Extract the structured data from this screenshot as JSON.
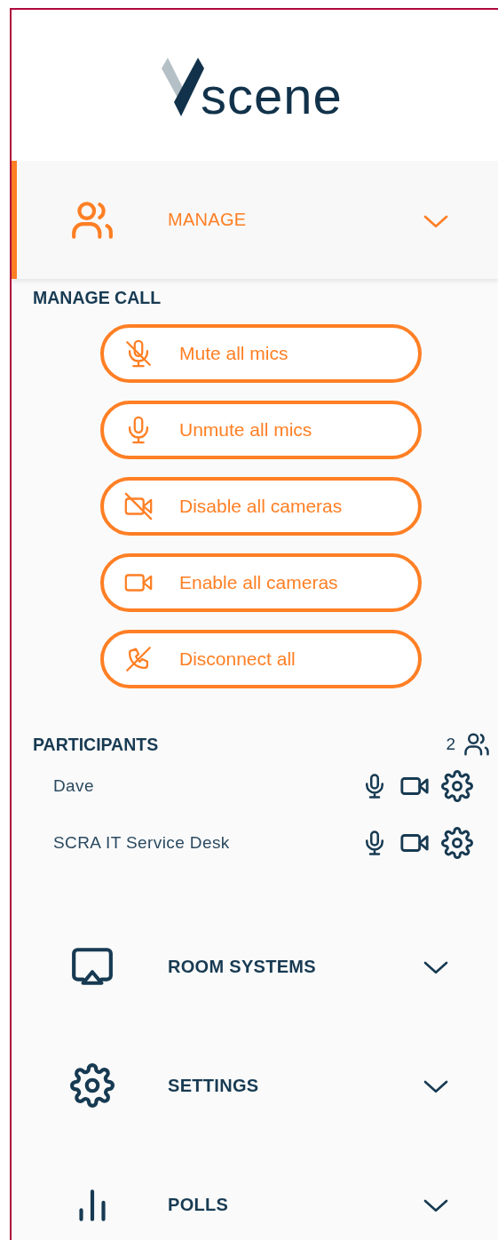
{
  "logo": {
    "text": "scene"
  },
  "sections": [
    {
      "label": "MANAGE",
      "selected": true,
      "manage_call": {
        "heading": "MANAGE CALL",
        "buttons": [
          "Mute all mics",
          "Unmute all mics",
          "Disable all cameras",
          "Enable all cameras",
          "Disconnect all"
        ]
      },
      "participants": {
        "heading": "PARTICIPANTS",
        "count": "2",
        "rows": [
          {
            "name": "Dave",
            "mic_muted": false,
            "camera_off": false
          },
          {
            "name": "SCRA IT Service Desk",
            "mic_muted": false,
            "camera_off": false
          }
        ]
      }
    },
    {
      "label": "ROOM SYSTEMS",
      "selected": false
    },
    {
      "label": "SETTINGS",
      "selected": false
    },
    {
      "label": "POLLS",
      "selected": false
    }
  ]
}
